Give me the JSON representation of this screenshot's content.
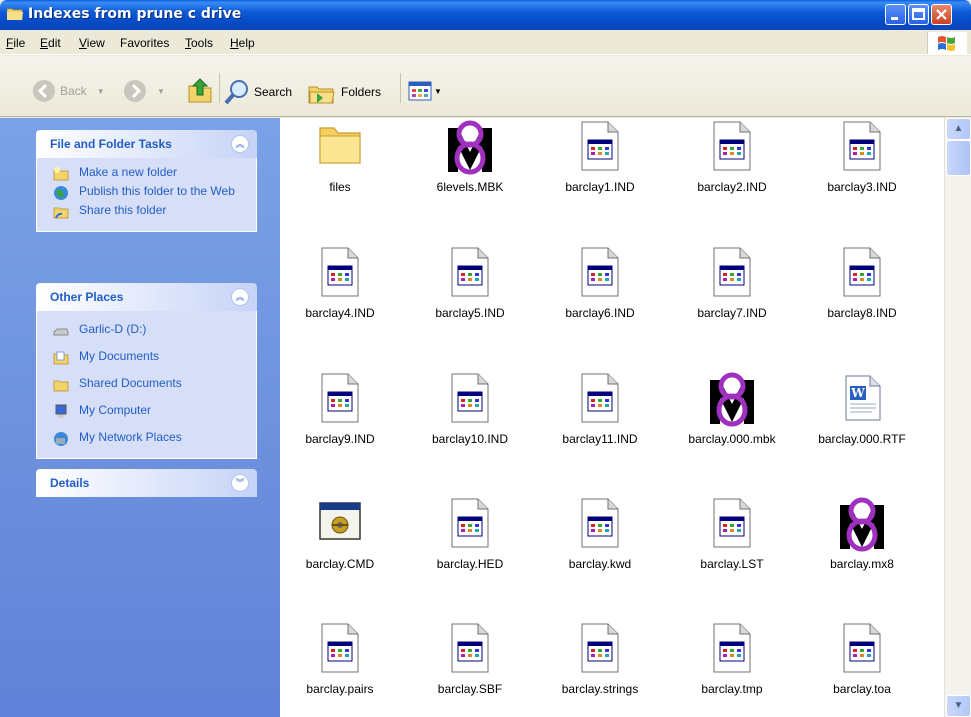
{
  "window": {
    "title": "Indexes from prune c drive"
  },
  "menu": [
    {
      "label": "File",
      "u": "F",
      "rest": "ile"
    },
    {
      "label": "Edit",
      "u": "E",
      "rest": "dit"
    },
    {
      "label": "View",
      "u": "V",
      "rest": "iew"
    },
    {
      "label": "Favorites",
      "u": "",
      "rest": "Favorites"
    },
    {
      "label": "Tools",
      "u": "T",
      "rest": "ools"
    },
    {
      "label": "Help",
      "u": "H",
      "rest": "elp"
    }
  ],
  "toolbar": {
    "back_label": "Back",
    "search_label": "Search",
    "folders_label": "Folders"
  },
  "tasks": {
    "title": "File and Folder Tasks",
    "items": [
      "Make a new folder",
      "Publish this folder to the Web",
      "Share this folder"
    ]
  },
  "places": {
    "title": "Other Places",
    "items": [
      "Garlic-D (D:)",
      "My Documents",
      "Shared Documents",
      "My Computer",
      "My Network Places"
    ]
  },
  "details": {
    "title": "Details"
  },
  "files": [
    {
      "name": "files",
      "icon": "folder-icon"
    },
    {
      "name": "6levels.MBK",
      "icon": "mbk-logo-icon"
    },
    {
      "name": "barclay1.IND",
      "icon": "document-icon"
    },
    {
      "name": "barclay2.IND",
      "icon": "document-icon"
    },
    {
      "name": "barclay3.IND",
      "icon": "document-icon"
    },
    {
      "name": "barclay4.IND",
      "icon": "document-icon"
    },
    {
      "name": "barclay5.IND",
      "icon": "document-icon"
    },
    {
      "name": "barclay6.IND",
      "icon": "document-icon"
    },
    {
      "name": "barclay7.IND",
      "icon": "document-icon"
    },
    {
      "name": "barclay8.IND",
      "icon": "document-icon"
    },
    {
      "name": "barclay9.IND",
      "icon": "document-icon"
    },
    {
      "name": "barclay10.IND",
      "icon": "document-icon"
    },
    {
      "name": "barclay11.IND",
      "icon": "document-icon"
    },
    {
      "name": "barclay.000.mbk",
      "icon": "mbk-logo-icon"
    },
    {
      "name": "barclay.000.RTF",
      "icon": "word-document-icon"
    },
    {
      "name": "barclay.CMD",
      "icon": "command-icon"
    },
    {
      "name": "barclay.HED",
      "icon": "document-icon"
    },
    {
      "name": "barclay.kwd",
      "icon": "document-icon"
    },
    {
      "name": "barclay.LST",
      "icon": "document-icon"
    },
    {
      "name": "barclay.mx8",
      "icon": "mbk-logo-icon"
    },
    {
      "name": "barclay.pairs",
      "icon": "document-icon"
    },
    {
      "name": "barclay.SBF",
      "icon": "document-icon"
    },
    {
      "name": "barclay.strings",
      "icon": "document-icon"
    },
    {
      "name": "barclay.tmp",
      "icon": "document-icon"
    },
    {
      "name": "barclay.toa",
      "icon": "document-icon"
    }
  ]
}
